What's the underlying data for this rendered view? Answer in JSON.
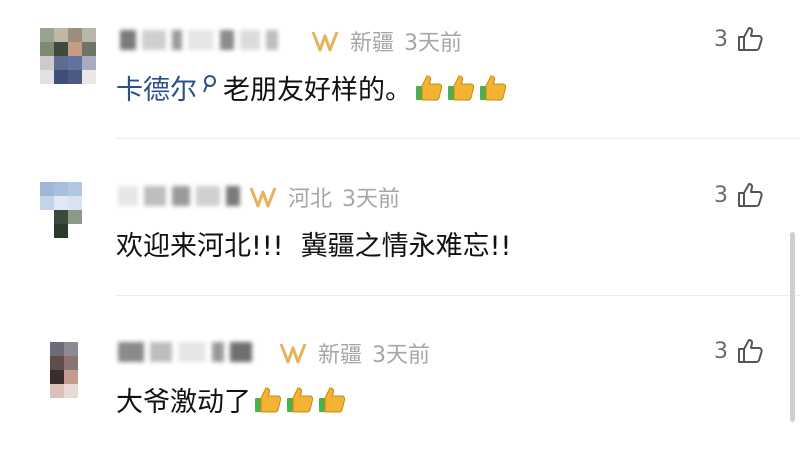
{
  "comments": [
    {
      "location": "新疆",
      "time": "3天前",
      "likes": "3",
      "mention": "卡德尔",
      "text": "老朋友好样的。",
      "emojis": [
        "thumbs-up",
        "thumbs-up",
        "thumbs-up"
      ]
    },
    {
      "location": "河北",
      "time": "3天前",
      "likes": "3",
      "text": "欢迎来河北!!!  冀疆之情永难忘!!",
      "emojis": []
    },
    {
      "location": "新疆",
      "time": "3天前",
      "likes": "3",
      "text": "大爷激动了",
      "emojis": [
        "thumbs-up",
        "thumbs-up",
        "thumbs-up"
      ]
    }
  ],
  "colors": {
    "meta_text": "#a6a6a6",
    "mention": "#2a4f8a",
    "vip_gold": "#e6b25a",
    "thumbs_yellow": "#f2b233",
    "thumbs_green": "#4caf50"
  },
  "icons": {
    "like": "thumbs-up-outline-icon",
    "vip": "vip-badge-icon",
    "search": "search-icon"
  }
}
